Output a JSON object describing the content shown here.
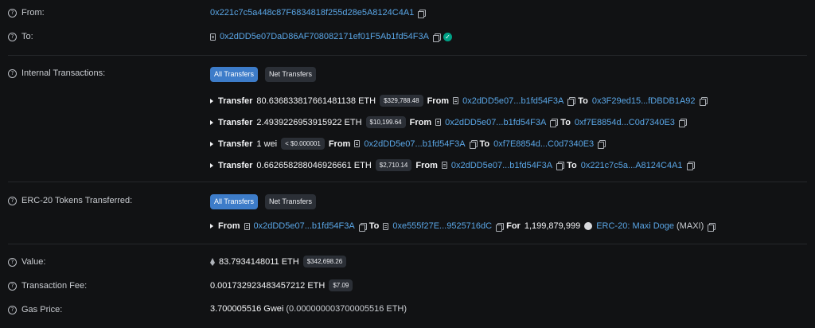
{
  "from": {
    "label": "From:",
    "address": "0x221c7c5a448c87F6834818f255d28e5A8124C4A1"
  },
  "to": {
    "label": "To:",
    "address": "0x2dDD5e07DaD86AF708082171ef01F5Ab1fd54F3A"
  },
  "internal": {
    "label": "Internal Transactions:",
    "tabs": [
      "All Transfers",
      "Net Transfers"
    ],
    "transfers": [
      {
        "prefix": "Transfer",
        "amount": "80.636833817661481138 ETH",
        "usd": "$329,788.48",
        "from_word": "From",
        "from_addr": "0x2dDD5e07...b1fd54F3A",
        "to_word": "To",
        "to_addr": "0x3F29ed15...fDBDB1A92"
      },
      {
        "prefix": "Transfer",
        "amount": "2.4939226953915922 ETH",
        "usd": "$10,199.64",
        "from_word": "From",
        "from_addr": "0x2dDD5e07...b1fd54F3A",
        "to_word": "To",
        "to_addr": "0xf7E8854d...C0d7340E3"
      },
      {
        "prefix": "Transfer",
        "amount": "1 wei",
        "usd": "< $0.000001",
        "from_word": "From",
        "from_addr": "0x2dDD5e07...b1fd54F3A",
        "to_word": "To",
        "to_addr": "0xf7E8854d...C0d7340E3"
      },
      {
        "prefix": "Transfer",
        "amount": "0.662658288046926661 ETH",
        "usd": "$2,710.14",
        "from_word": "From",
        "from_addr": "0x2dDD5e07...b1fd54F3A",
        "to_word": "To",
        "to_addr": "0x221c7c5a...A8124C4A1"
      }
    ]
  },
  "erc20": {
    "label": "ERC-20 Tokens Transferred:",
    "tabs": [
      "All Transfers",
      "Net Transfers"
    ],
    "from_word": "From",
    "from_addr": "0x2dDD5e07...b1fd54F3A",
    "to_word": "To",
    "to_addr": "0xe555f27E...9525716dC",
    "for_word": "For",
    "amount": "1,199,879,999",
    "token_name": "ERC-20: Maxi Doge",
    "token_symbol": "(MAXI)"
  },
  "value": {
    "label": "Value:",
    "amount": "83.7934148011 ETH",
    "usd": "$342,698.26"
  },
  "fee": {
    "label": "Transaction Fee:",
    "amount": "0.001732923483457212 ETH",
    "usd": "$7.09"
  },
  "gas": {
    "label": "Gas Price:",
    "gwei": "3.700005516 Gwei",
    "eth": "(0.000000003700005516 ETH)"
  },
  "colors": {
    "background": "#111214",
    "link": "#5aa6e6",
    "accent": "#3d7cc9",
    "success": "#00a186"
  }
}
